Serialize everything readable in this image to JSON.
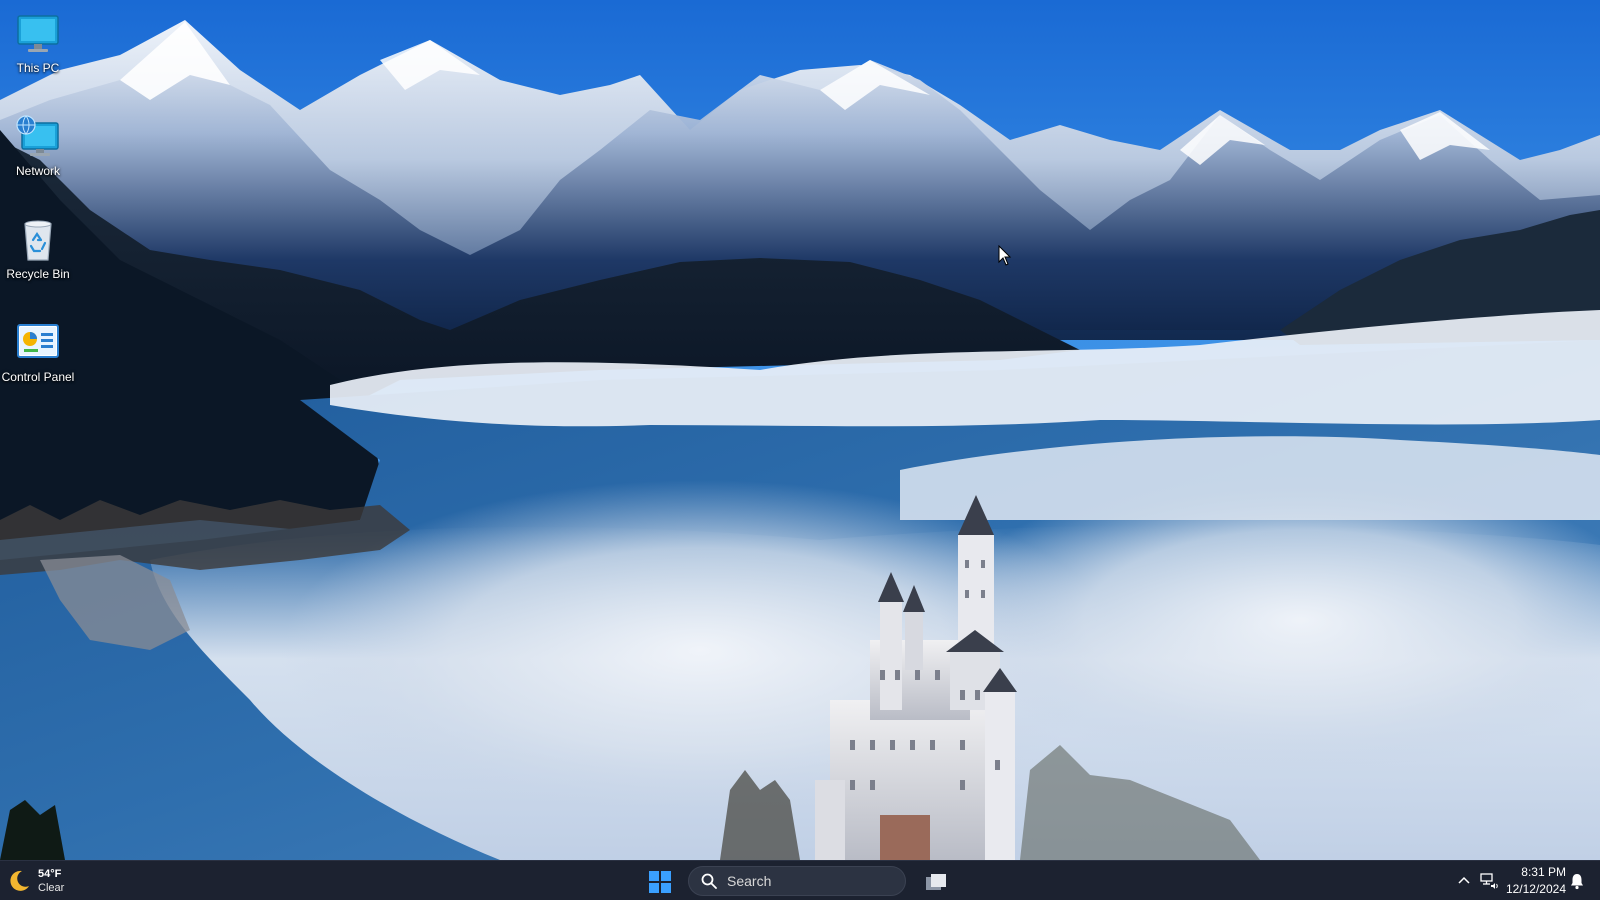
{
  "desktop": {
    "icons": [
      {
        "label": "This PC",
        "icon": "monitor-icon"
      },
      {
        "label": "Network",
        "icon": "network-icon"
      },
      {
        "label": "Recycle Bin",
        "icon": "recycle-bin-icon"
      },
      {
        "label": "Control Panel",
        "icon": "control-panel-icon"
      }
    ]
  },
  "taskbar": {
    "weather": {
      "temperature": "54°F",
      "condition": "Clear",
      "icon": "moon-icon"
    },
    "search": {
      "placeholder": "Search",
      "icon": "search-icon"
    },
    "start_icon": "windows-logo-icon",
    "taskview_icon": "task-view-icon",
    "tray": {
      "time": "8:31 PM",
      "date": "12/12/2024",
      "icons": [
        "chevron-up-icon",
        "network-volume-icon",
        "notification-bell-icon"
      ]
    }
  },
  "colors": {
    "taskbar_bg": "#1c2230",
    "sky_top": "#1c6fd6",
    "accent": "#3aa0ff"
  }
}
